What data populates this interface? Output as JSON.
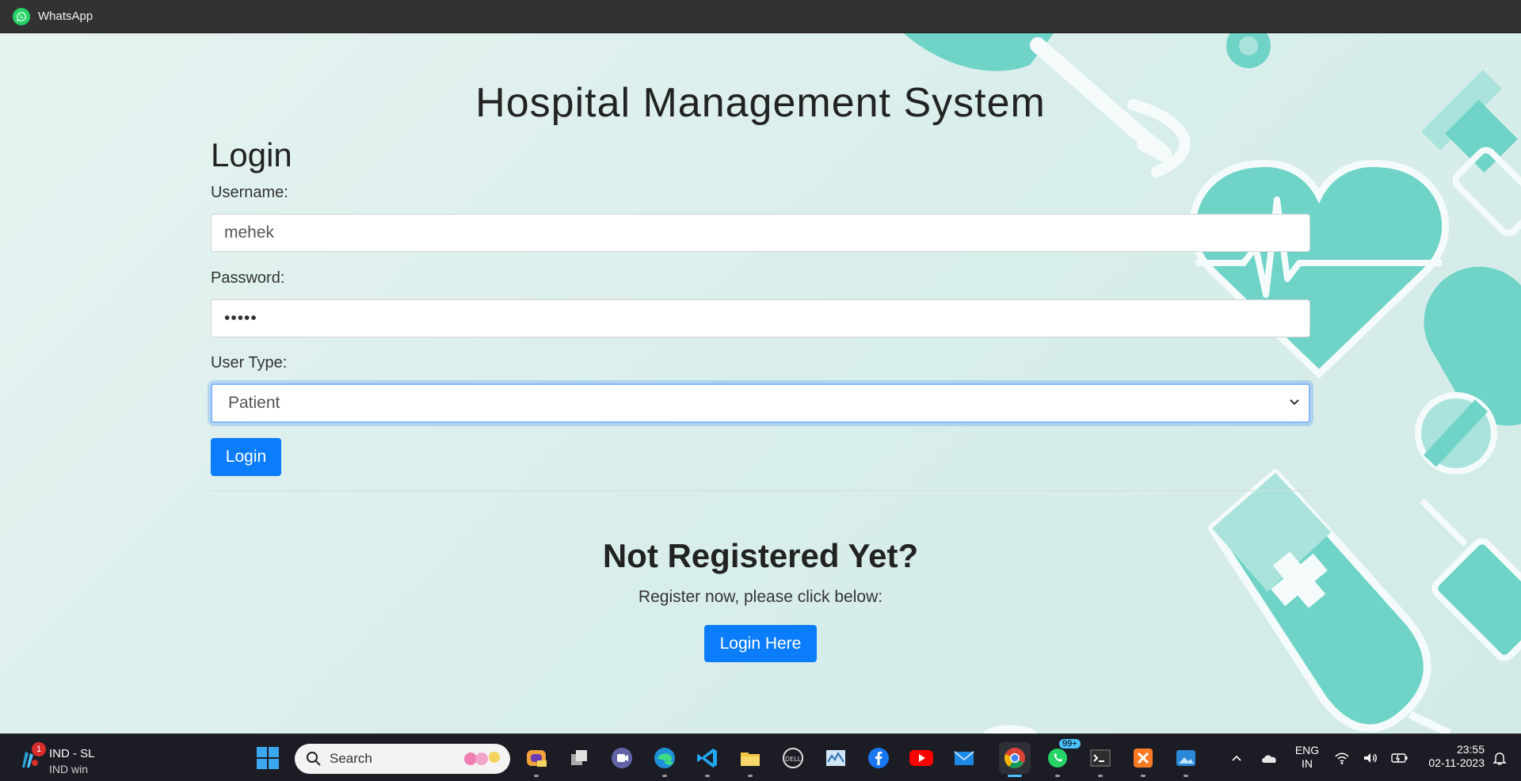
{
  "window": {
    "title": "WhatsApp"
  },
  "page": {
    "title": "Hospital Management System",
    "section_title": "Login"
  },
  "form": {
    "username_label": "Username:",
    "username_value": "mehek",
    "password_label": "Password:",
    "password_value": "•••••",
    "usertype_label": "User Type:",
    "usertype_value": "Patient",
    "login_button": "Login"
  },
  "register": {
    "title": "Not Registered Yet?",
    "text": "Register now, please click below:",
    "button": "Login Here"
  },
  "colors": {
    "accent": "#0b7dfb",
    "decor": "#6fd3c7",
    "background": "#dcefec"
  },
  "taskbar": {
    "news": {
      "line1": "IND - SL",
      "line2": "IND win",
      "badge": "1"
    },
    "search_placeholder": "Search",
    "whatsapp_badge": "99+",
    "language": {
      "line1": "ENG",
      "line2": "IN"
    },
    "clock": {
      "time": "23:55",
      "date": "02-11-2023"
    },
    "apps": [
      "start-icon",
      "copilot-icon",
      "task-view-icon",
      "teams-icon",
      "edge-icon",
      "vscode-icon",
      "file-explorer-icon",
      "dell-icon",
      "monitor-icon",
      "facebook-icon",
      "youtube-icon",
      "mail-icon",
      "chrome-icon",
      "whatsapp-icon",
      "terminal-icon",
      "xampp-icon",
      "photos-icon"
    ]
  }
}
